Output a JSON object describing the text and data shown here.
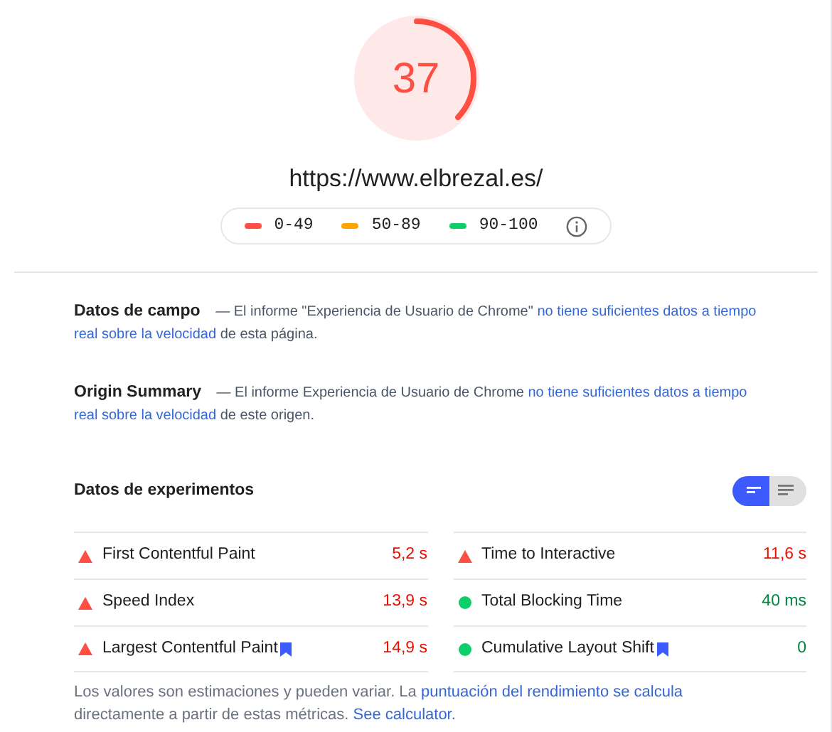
{
  "score": {
    "value": "37",
    "level": 0.37,
    "color": "#ff4e42"
  },
  "url": "https://www.elbrezal.es/",
  "legend": [
    {
      "range": "0-49",
      "color": "#ff4e42"
    },
    {
      "range": "50-89",
      "color": "#ffa400"
    },
    {
      "range": "90-100",
      "color": "#0cce6b"
    }
  ],
  "sections": [
    {
      "title": "Datos de campo",
      "parts": [
        {
          "text": "— El informe \"Experiencia de Usuario de Chrome\"",
          "link": false
        },
        {
          "text": "no tiene suficientes datos a tiempo",
          "link": true
        },
        {
          "text": "real sobre la velocidad",
          "link": true
        },
        {
          "text": "de esta página.",
          "link": false
        }
      ]
    },
    {
      "title": "Origin Summary",
      "parts": [
        {
          "text": "— El informe Experiencia de Usuario de Chrome",
          "link": false
        },
        {
          "text": "no tiene suficientes datos a tiempo",
          "link": true
        },
        {
          "text": "real sobre la velocidad",
          "link": true
        },
        {
          "text": "de este origen.",
          "link": false
        }
      ]
    }
  ],
  "lab": {
    "title": "Datos de experimentos",
    "view_toggle": [
      {
        "kind": "compact",
        "selected": true
      },
      {
        "kind": "expanded",
        "selected": false
      }
    ],
    "metrics": [
      {
        "name": "First Contentful Paint",
        "value": "5,2 s",
        "kind": "fail",
        "bookmark": false
      },
      {
        "name": "Time to Interactive",
        "value": "11,6 s",
        "kind": "fail",
        "bookmark": false
      },
      {
        "name": "Speed Index",
        "value": "13,9 s",
        "kind": "fail",
        "bookmark": false
      },
      {
        "name": "Total Blocking Time",
        "value": "40 ms",
        "kind": "pass",
        "bookmark": false
      },
      {
        "name": "Largest Contentful Paint",
        "value": "14,9 s",
        "kind": "fail",
        "bookmark": true
      },
      {
        "name": "Cumulative Layout Shift",
        "value": "0",
        "kind": "pass",
        "bookmark": true
      }
    ]
  },
  "footer": {
    "parts": [
      {
        "text": "Los valores son estimaciones y pueden variar. La",
        "link": false
      },
      {
        "text": "puntuación del rendimiento se calcula",
        "link": true
      },
      {
        "text": "directamente a partir de estas métricas.",
        "link": false
      },
      {
        "text": "See calculator.",
        "link": true
      }
    ]
  }
}
